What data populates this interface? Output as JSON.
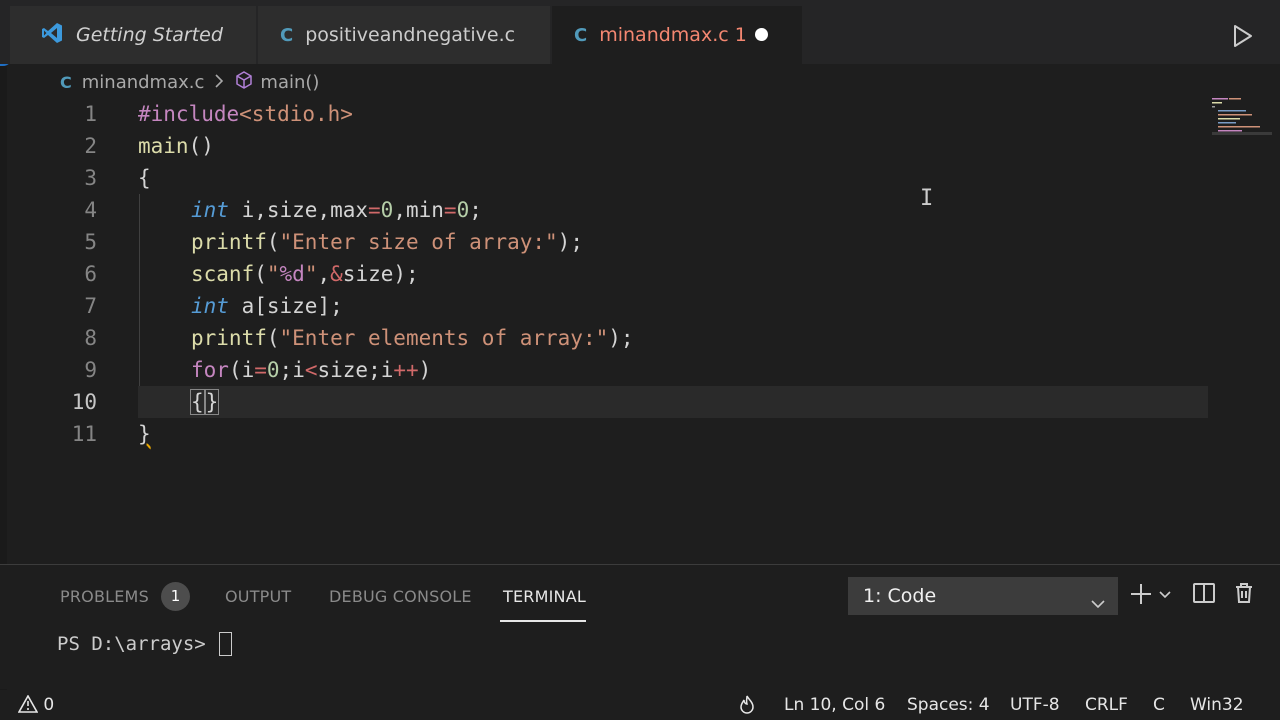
{
  "tabs": [
    {
      "label": "Getting Started",
      "icon": "vscode-logo-icon"
    },
    {
      "label": "positiveandnegative.c",
      "icon": "c-file-icon"
    },
    {
      "label": "minandmax.c 1",
      "icon": "c-file-icon",
      "active": true,
      "dirty": true
    }
  ],
  "icon_letters": {
    "c": "C"
  },
  "breadcrumb": {
    "file": "minandmax.c",
    "symbol": "main()"
  },
  "editor": {
    "line_numbers": [
      "1",
      "2",
      "3",
      "4",
      "5",
      "6",
      "7",
      "8",
      "9",
      "10",
      "11"
    ],
    "active_line": "10",
    "code": {
      "l1": {
        "a": "#include",
        "b": "<stdio.h>"
      },
      "l2": {
        "a": "main",
        "b": "()"
      },
      "l3": {
        "a": "{"
      },
      "l4": {
        "a": "int",
        "b": " i,size,max",
        "c": "=",
        "d": "0",
        "e": ",min",
        "f": "=",
        "g": "0",
        "h": ";"
      },
      "l5": {
        "a": "printf",
        "b": "(",
        "c": "\"Enter size of array:\"",
        "d": ");"
      },
      "l6": {
        "a": "scanf",
        "b": "(",
        "c": "\"",
        "d": "%d",
        "e": "\"",
        "f": ",",
        "g": "&",
        "h": "size);"
      },
      "l7": {
        "a": "int",
        "b": " a[size];"
      },
      "l8": {
        "a": "printf",
        "b": "(",
        "c": "\"Enter elements of array:\"",
        "d": ");"
      },
      "l9": {
        "a": "for",
        "b": "(i",
        "c": "=",
        "d": "0",
        "e": ";i",
        "f": "<",
        "g": "size;i",
        "h": "++",
        "i": ")"
      },
      "l10": {
        "a": "{",
        "b": "}"
      },
      "l11": {
        "a": "}"
      }
    }
  },
  "panel": {
    "tabs": {
      "problems": "PROBLEMS",
      "output": "OUTPUT",
      "debug": "DEBUG CONSOLE",
      "terminal": "TERMINAL"
    },
    "problems_count": "1",
    "terminal_select": "1: Code",
    "prompt": "PS D:\\arrays> "
  },
  "status": {
    "warnings": "0",
    "position": "Ln 10, Col 6",
    "spaces": "Spaces: 4",
    "encoding": "UTF-8",
    "eol": "CRLF",
    "language": "C",
    "platform": "Win32"
  },
  "colors": {
    "accent": "#007acc",
    "modified_tab": "#f48771",
    "c_icon": "#519aba"
  }
}
